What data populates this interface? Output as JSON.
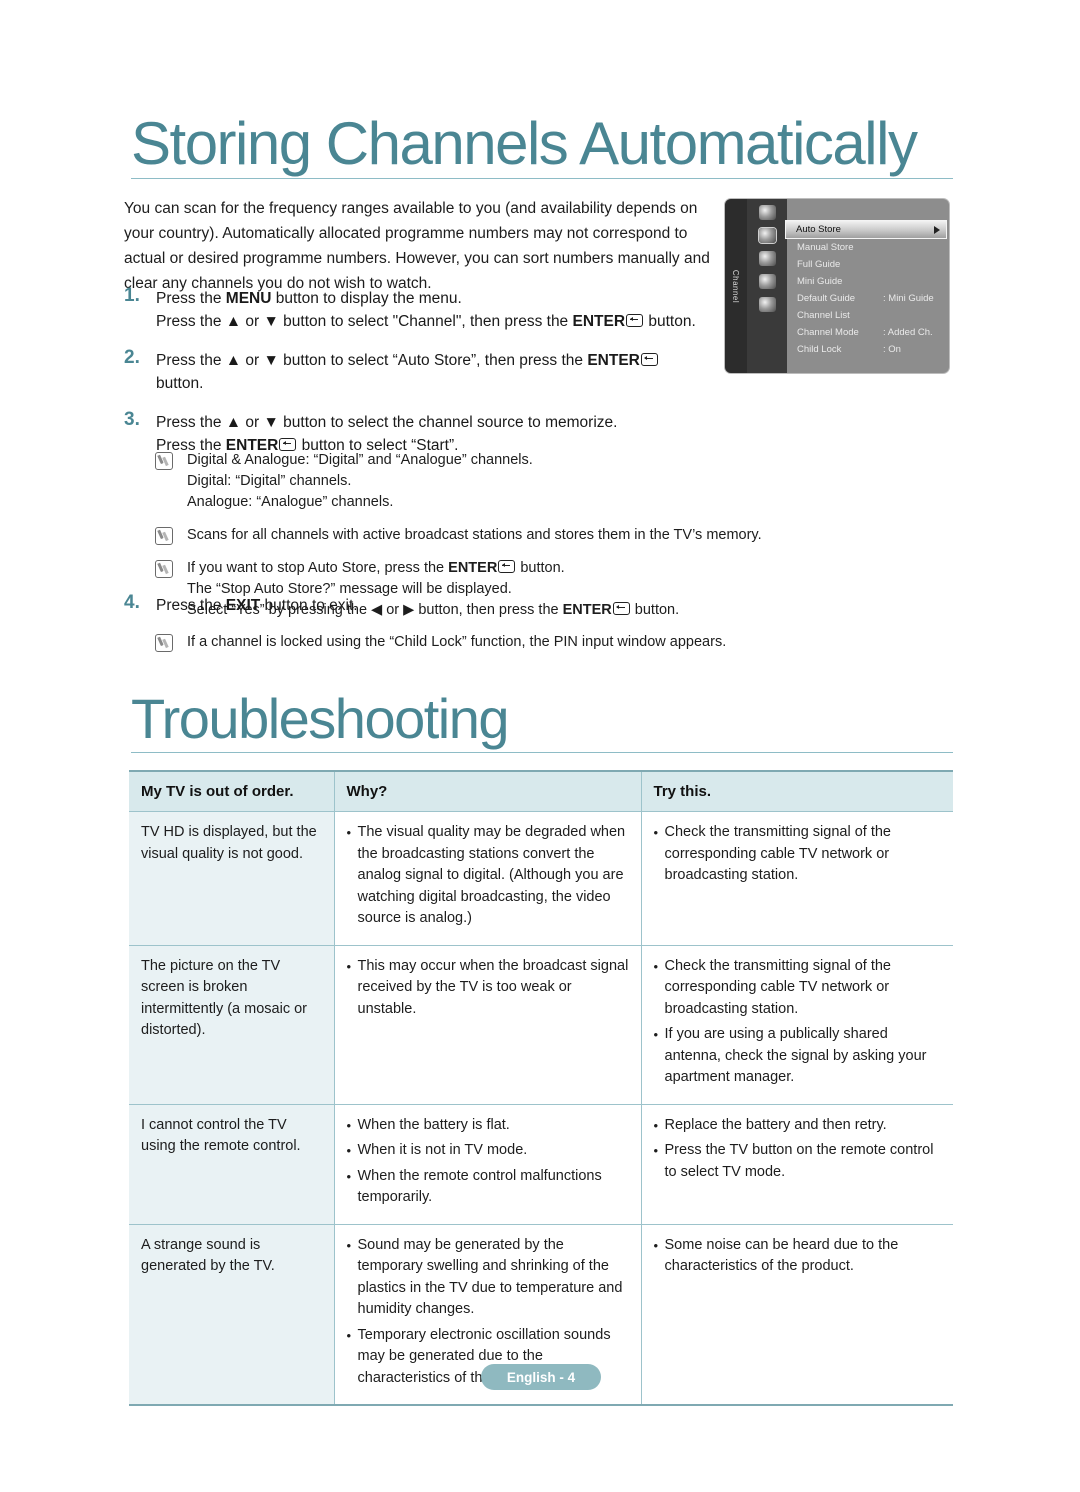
{
  "sections": {
    "storing_title": "Storing Channels Automatically",
    "troubleshooting_title": "Troubleshooting"
  },
  "intro": "You can scan for the frequency ranges available to you (and availability depends on your country). Automatically allocated programme numbers may not correspond to actual or desired programme numbers. However, you can sort numbers manually and clear any channels you do not wish to watch.",
  "steps": [
    {
      "num": "1.",
      "lines": [
        {
          "pre": "Press the ",
          "bold": "MENU",
          "post": " button to display the menu.",
          "enter": false
        },
        {
          "pre": "Press the ▲ or ▼ button to select \"Channel\", then press the ",
          "bold": "ENTER",
          "post": " button.",
          "enter": true
        }
      ]
    },
    {
      "num": "2.",
      "lines": [
        {
          "pre": "Press the ▲ or ▼ button to select “Auto Store”, then press the ",
          "bold": "ENTER",
          "post": "",
          "enter": true
        },
        {
          "pre": "button.",
          "bold": "",
          "post": "",
          "enter": false
        }
      ]
    },
    {
      "num": "3.",
      "lines": [
        {
          "pre": "Press the ▲ or ▼ button to select the channel source to memorize.",
          "bold": "",
          "post": "",
          "enter": false
        },
        {
          "pre": "Press the ",
          "bold": "ENTER",
          "post": " button to select “Start”.",
          "enter": true
        }
      ]
    }
  ],
  "step4": {
    "num": "4.",
    "lines": [
      {
        "pre": "Press the ",
        "bold": "EXIT",
        "post": " button to exit.",
        "enter": false
      }
    ]
  },
  "notes_group1": [
    {
      "lines": [
        {
          "pre": "Digital & Analogue: “Digital” and “Analogue” channels.",
          "bold": "",
          "post": "",
          "enter": false
        },
        {
          "pre": "Digital: “Digital” channels.",
          "bold": "",
          "post": "",
          "enter": false
        },
        {
          "pre": "Analogue: “Analogue” channels.",
          "bold": "",
          "post": "",
          "enter": false
        }
      ]
    },
    {
      "lines": [
        {
          "pre": "Scans for all channels with active broadcast stations and stores them in the TV’s memory.",
          "bold": "",
          "post": "",
          "enter": false
        }
      ]
    },
    {
      "lines": [
        {
          "pre": "If you want to stop Auto Store, press the ",
          "bold": "ENTER",
          "post": " button.",
          "enter": true
        },
        {
          "pre": "The “Stop Auto Store?” message will be displayed.",
          "bold": "",
          "post": "",
          "enter": false
        },
        {
          "pre": "Select “Yes” by pressing the ◀ or ▶ button, then press the ",
          "bold": "ENTER",
          "post": " button.",
          "enter": true
        }
      ]
    }
  ],
  "notes_group2": [
    {
      "lines": [
        {
          "pre": "If a channel is locked using the “Child Lock” function, the PIN input window appears.",
          "bold": "",
          "post": "",
          "enter": false
        }
      ]
    }
  ],
  "osd": {
    "rail_label": "Channel",
    "rows": [
      {
        "label": "Auto Store",
        "value": "",
        "highlighted": true,
        "arrow": true
      },
      {
        "label": "Manual Store",
        "value": "",
        "highlighted": false,
        "arrow": false
      },
      {
        "label": "Full Guide",
        "value": "",
        "highlighted": false,
        "arrow": false
      },
      {
        "label": "Mini Guide",
        "value": "",
        "highlighted": false,
        "arrow": false
      },
      {
        "label": "Default Guide",
        "value": ": Mini Guide",
        "highlighted": false,
        "arrow": false
      },
      {
        "label": "Channel List",
        "value": "",
        "highlighted": false,
        "arrow": false
      },
      {
        "label": "Channel Mode",
        "value": ": Added Ch.",
        "highlighted": false,
        "arrow": false
      },
      {
        "label": "Child Lock",
        "value": ": On",
        "highlighted": false,
        "arrow": false
      }
    ],
    "icons": [
      "power-icon",
      "channel-icon",
      "setup-icon",
      "sound-icon",
      "picture-icon"
    ]
  },
  "table": {
    "headers": [
      "My TV is out of order.",
      "Why?",
      "Try this."
    ],
    "rows": [
      {
        "symptom": [
          "TV HD is displayed, but the visual quality is not good."
        ],
        "why": [
          "The visual quality may be degraded when the broadcasting stations convert the analog signal to digital. (Although you are watching digital broadcasting, the video source is analog.)"
        ],
        "try": [
          "Check the transmitting signal of the corresponding cable TV network or broadcasting station."
        ]
      },
      {
        "symptom": [
          "The picture on the TV screen is broken intermittently (a mosaic or distorted)."
        ],
        "why": [
          "This may occur when the broadcast signal received by the TV is too weak or unstable."
        ],
        "try": [
          "Check the transmitting signal of the corresponding cable TV network or broadcasting station.",
          "If you are using a publically shared antenna, check the signal by asking your apartment manager."
        ]
      },
      {
        "symptom": [
          "I cannot control the TV using the remote control."
        ],
        "why": [
          "When the battery is flat.",
          "When it is not in TV mode.",
          "When the remote control malfunctions temporarily."
        ],
        "try": [
          "Replace the battery and then retry.",
          "Press the TV button on the remote control to select TV mode."
        ]
      },
      {
        "symptom": [
          "A strange sound is generated by the TV."
        ],
        "why": [
          "Sound may be generated by the temporary swelling and shrinking of the plastics in the TV due to temperature and humidity changes.",
          "Temporary electronic oscillation sounds may be generated due to the characteristics of the TV"
        ],
        "try": [
          "Some noise can be heard due to the characteristics of the product."
        ]
      }
    ]
  },
  "footer": {
    "label": "English - 4"
  },
  "colors": {
    "heading": "#4a8693",
    "table_header_bg": "#d8e9ec",
    "table_first_col_bg": "#e9f2f4",
    "footer_badge": "#8fb9c0"
  }
}
